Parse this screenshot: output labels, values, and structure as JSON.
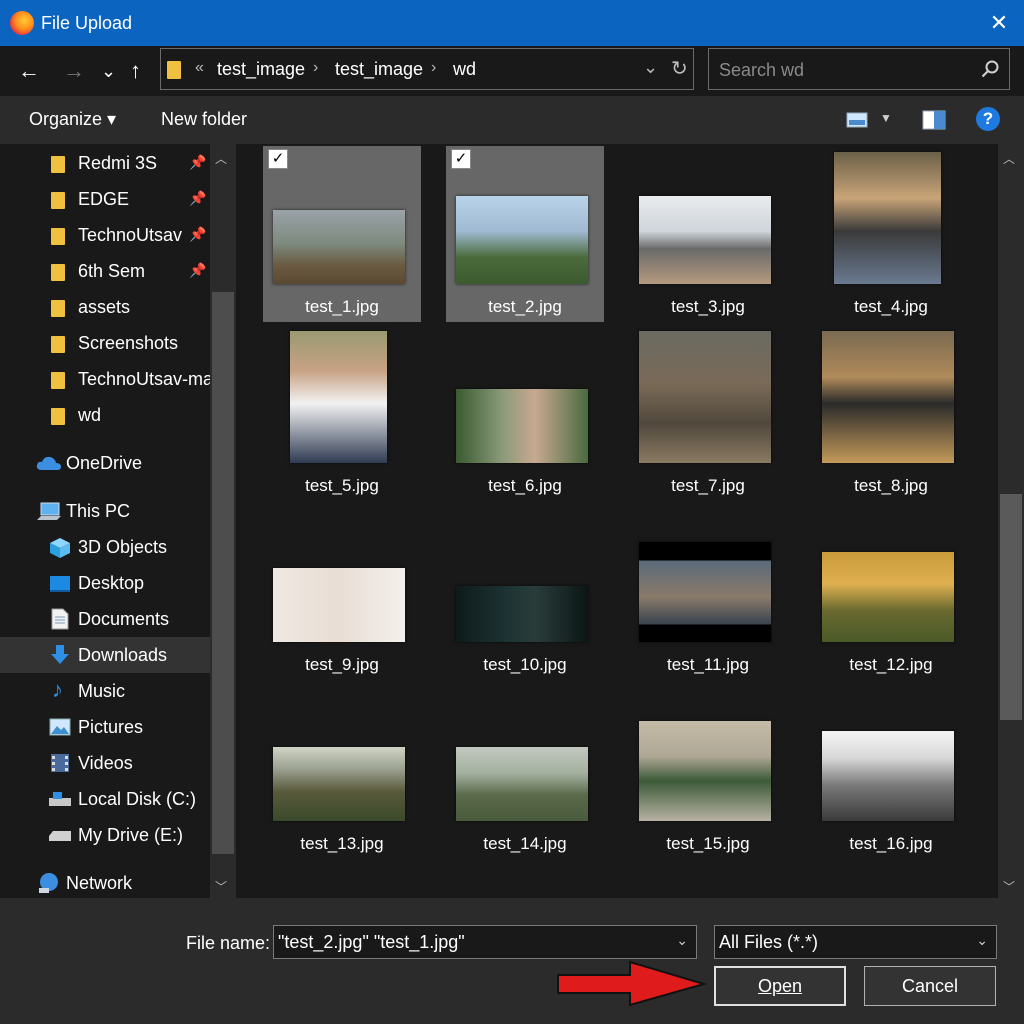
{
  "window": {
    "title": "File Upload",
    "close_glyph": "✕"
  },
  "nav": {
    "back": "←",
    "forward": "→",
    "recent": "⌄",
    "up": "↑"
  },
  "address": {
    "overflow": "«",
    "crumbs": [
      "test_image",
      "test_image",
      "wd"
    ],
    "sep": "›",
    "dropdown": "⌄",
    "refresh": "↻"
  },
  "search": {
    "placeholder": "Search wd",
    "icon": "search-icon"
  },
  "toolbar": {
    "organize": "Organize ▾",
    "new_folder": "New folder",
    "help": "?"
  },
  "sidebar": {
    "items": [
      {
        "label": "Redmi 3S",
        "icon": "folder-icon",
        "pinned": true
      },
      {
        "label": "EDGE",
        "icon": "folder-icon",
        "pinned": true
      },
      {
        "label": "TechnoUtsav",
        "icon": "folder-icon",
        "pinned": true
      },
      {
        "label": "6th Sem",
        "icon": "folder-icon",
        "pinned": true
      },
      {
        "label": "assets",
        "icon": "folder-icon"
      },
      {
        "label": "Screenshots",
        "icon": "folder-icon"
      },
      {
        "label": "TechnoUtsav-ma",
        "icon": "folder-icon"
      },
      {
        "label": "wd",
        "icon": "folder-icon"
      },
      {
        "label": "OneDrive",
        "icon": "cloud-icon"
      },
      {
        "label": "This PC",
        "icon": "pc-icon"
      },
      {
        "label": "3D Objects",
        "icon": "cube-icon"
      },
      {
        "label": "Desktop",
        "icon": "desktop-icon"
      },
      {
        "label": "Documents",
        "icon": "document-icon"
      },
      {
        "label": "Downloads",
        "icon": "download-icon",
        "selected": true
      },
      {
        "label": "Music",
        "icon": "music-icon"
      },
      {
        "label": "Pictures",
        "icon": "pictures-icon"
      },
      {
        "label": "Videos",
        "icon": "video-icon"
      },
      {
        "label": "Local Disk (C:)",
        "icon": "drive-icon"
      },
      {
        "label": "My Drive (E:)",
        "icon": "drive-icon"
      },
      {
        "label": "Network",
        "icon": "network-icon"
      }
    ]
  },
  "files": [
    {
      "name": "test_1.jpg",
      "selected": true
    },
    {
      "name": "test_2.jpg",
      "selected": true
    },
    {
      "name": "test_3.jpg"
    },
    {
      "name": "test_4.jpg"
    },
    {
      "name": "test_5.jpg"
    },
    {
      "name": "test_6.jpg"
    },
    {
      "name": "test_7.jpg"
    },
    {
      "name": "test_8.jpg"
    },
    {
      "name": "test_9.jpg"
    },
    {
      "name": "test_10.jpg"
    },
    {
      "name": "test_11.jpg"
    },
    {
      "name": "test_12.jpg"
    },
    {
      "name": "test_13.jpg"
    },
    {
      "name": "test_14.jpg"
    },
    {
      "name": "test_15.jpg"
    },
    {
      "name": "test_16.jpg"
    }
  ],
  "check_glyph": "✓",
  "footer": {
    "filename_label": "File name:",
    "filename_value": "\"test_2.jpg\" \"test_1.jpg\"",
    "filetype_value": "All Files (*.*)",
    "dropdown": "⌄",
    "open": "Open",
    "cancel": "Cancel"
  },
  "colors": {
    "accent": "#0a64c0",
    "annotation_arrow": "#e01b1b"
  }
}
